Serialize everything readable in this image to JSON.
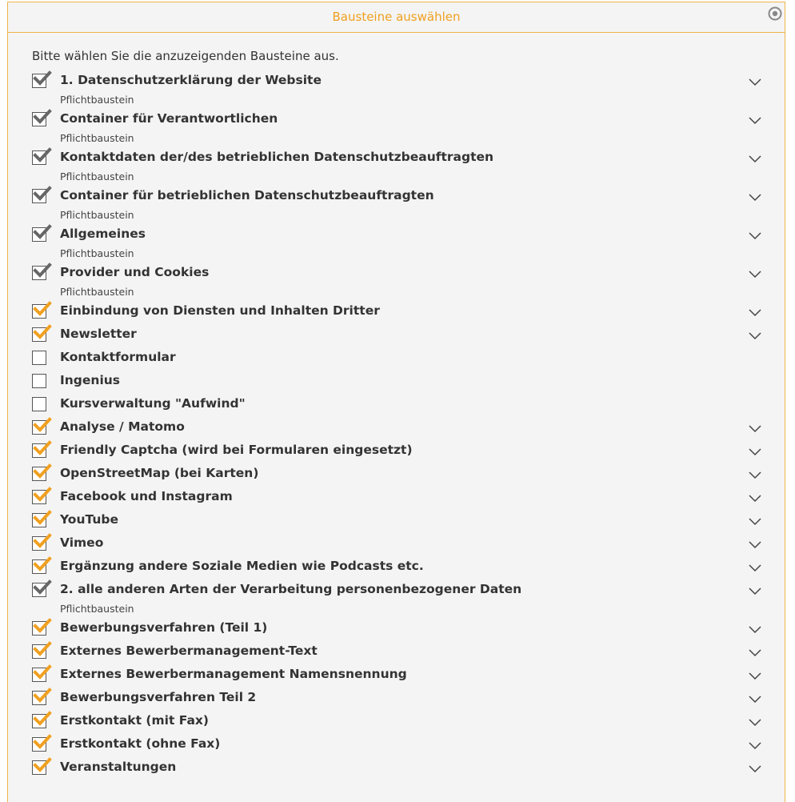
{
  "panel": {
    "title": "Bausteine auswählen",
    "intro": "Bitte wählen Sie die anzuzeigenden Bausteine aus.",
    "accent": "#f0a020"
  },
  "colors": {
    "required_check": "#666666",
    "optional_check": "#f0a020"
  },
  "items": [
    {
      "label": "1. Datenschutzerklärung der Website",
      "sub": "Pflichtbaustein",
      "state": "required",
      "chevron": true
    },
    {
      "label": "Container für Verantwortlichen",
      "sub": "Pflichtbaustein",
      "state": "required",
      "chevron": true
    },
    {
      "label": "Kontaktdaten der/des betrieblichen Datenschutzbeauftragten",
      "sub": "Pflichtbaustein",
      "state": "required",
      "chevron": true
    },
    {
      "label": "Container für betrieblichen Datenschutzbeauftragten",
      "sub": "Pflichtbaustein",
      "state": "required",
      "chevron": true
    },
    {
      "label": "Allgemeines",
      "sub": "Pflichtbaustein",
      "state": "required",
      "chevron": true
    },
    {
      "label": "Provider und Cookies",
      "sub": "Pflichtbaustein",
      "state": "required",
      "chevron": true
    },
    {
      "label": "Einbindung von Diensten und Inhalten Dritter",
      "sub": "",
      "state": "checked",
      "chevron": true
    },
    {
      "label": "Newsletter",
      "sub": "",
      "state": "checked",
      "chevron": true
    },
    {
      "label": "Kontaktformular",
      "sub": "",
      "state": "unchecked",
      "chevron": false
    },
    {
      "label": "Ingenius",
      "sub": "",
      "state": "unchecked",
      "chevron": false
    },
    {
      "label": "Kursverwaltung \"Aufwind\"",
      "sub": "",
      "state": "unchecked",
      "chevron": false
    },
    {
      "label": "Analyse / Matomo",
      "sub": "",
      "state": "checked",
      "chevron": true
    },
    {
      "label": "Friendly Captcha (wird bei Formularen eingesetzt)",
      "sub": "",
      "state": "checked",
      "chevron": true
    },
    {
      "label": "OpenStreetMap (bei Karten)",
      "sub": "",
      "state": "checked",
      "chevron": true
    },
    {
      "label": "Facebook und Instagram",
      "sub": "",
      "state": "checked",
      "chevron": true
    },
    {
      "label": "YouTube",
      "sub": "",
      "state": "checked",
      "chevron": true
    },
    {
      "label": "Vimeo",
      "sub": "",
      "state": "checked",
      "chevron": true
    },
    {
      "label": "Ergänzung andere Soziale Medien wie Podcasts etc.",
      "sub": "",
      "state": "checked",
      "chevron": true
    },
    {
      "label": "2. alle anderen Arten der Verarbeitung personenbezogener Daten",
      "sub": "Pflichtbaustein",
      "state": "required",
      "chevron": true
    },
    {
      "label": "Bewerbungsverfahren (Teil 1)",
      "sub": "",
      "state": "checked",
      "chevron": true
    },
    {
      "label": "Externes Bewerbermanagement-Text",
      "sub": "",
      "state": "checked",
      "chevron": true
    },
    {
      "label": "Externes Bewerbermanagement Namensnennung",
      "sub": "",
      "state": "checked",
      "chevron": true
    },
    {
      "label": "Bewerbungsverfahren Teil 2",
      "sub": "",
      "state": "checked",
      "chevron": true
    },
    {
      "label": "Erstkontakt (mit Fax)",
      "sub": "",
      "state": "checked",
      "chevron": true
    },
    {
      "label": "Erstkontakt (ohne Fax)",
      "sub": "",
      "state": "checked",
      "chevron": true
    },
    {
      "label": "Veranstaltungen",
      "sub": "",
      "state": "checked",
      "chevron": true
    }
  ]
}
